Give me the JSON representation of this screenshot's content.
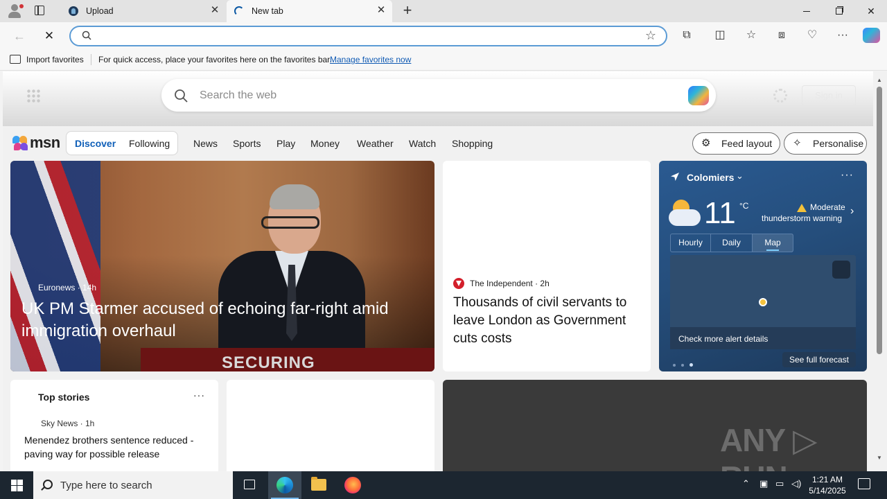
{
  "browser": {
    "tabs": [
      {
        "title": "Upload",
        "close": "✕"
      },
      {
        "title": "New tab",
        "close": "✕"
      }
    ],
    "new_tab": "+",
    "address": {
      "value": "",
      "placeholder": ""
    },
    "favorites_bar": {
      "import_label": "Import favorites",
      "message": "For quick access, place your favorites here on the favorites bar.",
      "link": "Manage favorites now"
    }
  },
  "page": {
    "search_placeholder": "Search the web",
    "sign_in": "Sign in",
    "logo": "msn",
    "feed_tabs": [
      "Discover",
      "Following"
    ],
    "nav": [
      "News",
      "Sports",
      "Play",
      "Money",
      "Weather",
      "Watch",
      "Shopping"
    ],
    "feed_layout": "Feed layout",
    "personalise": "Personalise",
    "hero": {
      "source": "Euronews · 14h",
      "headline": "UK PM Starmer accused of echoing far-right amid immigration overhaul",
      "image_text": "SECURING"
    },
    "independent": {
      "source": "The Independent · 2h",
      "headline": "Thousands of civil servants to leave London as Government cuts costs"
    },
    "weather": {
      "location": "Colomiers",
      "more": "···",
      "temperature": "11",
      "unit": "°C",
      "warning_line1": "Moderate",
      "warning_line2": "thunderstorm warning",
      "tabs": [
        "Hourly",
        "Daily",
        "Map"
      ],
      "alert": "Check more alert details",
      "forecast": "See full forecast"
    },
    "top_stories": {
      "title": "Top stories",
      "more": "···",
      "source": "Sky News · 1h",
      "headline": "Menendez brothers sentence reduced - paving way for possible release"
    },
    "watermark": "ANY ▷ RUN"
  },
  "taskbar": {
    "search_placeholder": "Type here to search",
    "time": "1:21 AM",
    "date": "5/14/2025"
  },
  "colors": {
    "accent": "#0f5fb8",
    "address_border": "#5b9bd5",
    "weather_bg": "#254e7c",
    "taskbar": "#1c2630"
  }
}
